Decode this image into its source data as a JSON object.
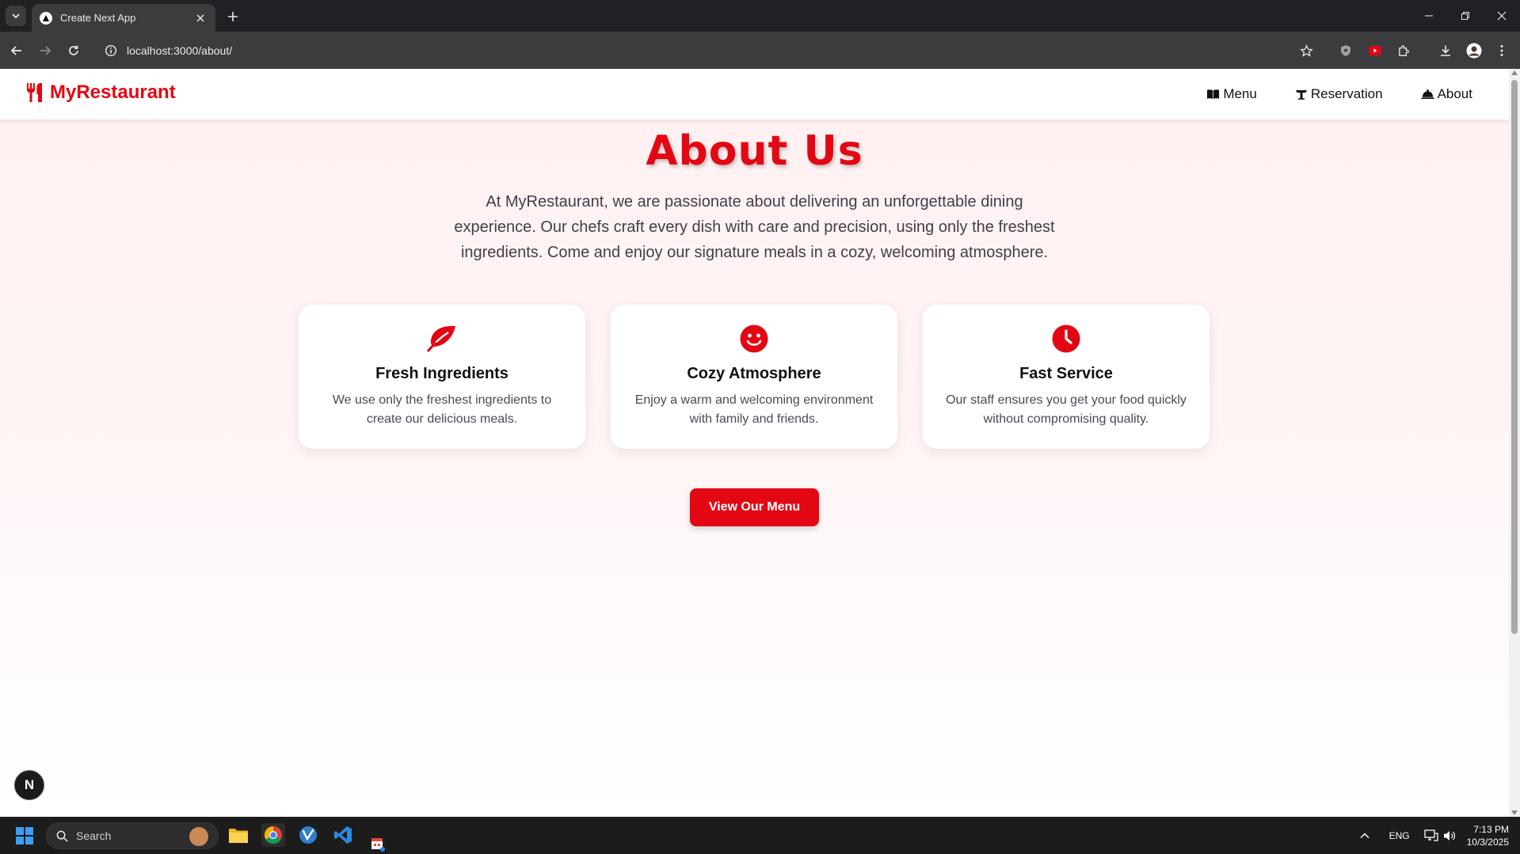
{
  "browser": {
    "tab_title": "Create Next App",
    "url": "localhost:3000/about/"
  },
  "site": {
    "brand": "MyRestaurant",
    "nav": [
      {
        "label": "Menu",
        "icon": "book-icon"
      },
      {
        "label": "Reservation",
        "icon": "table-icon"
      },
      {
        "label": "About",
        "icon": "cloche-icon"
      }
    ]
  },
  "about": {
    "title": "About Us",
    "description": "At MyRestaurant, we are passionate about delivering an unforgettable dining experience. Our chefs craft every dish with care and precision, using only the freshest ingredients. Come and enjoy our signature meals in a cozy, welcoming atmosphere.",
    "features": [
      {
        "icon": "leaf-icon",
        "title": "Fresh Ingredients",
        "text": "We use only the freshest ingredients to create our delicious meals."
      },
      {
        "icon": "smile-icon",
        "title": "Cozy Atmosphere",
        "text": "Enjoy a warm and welcoming environment with family and friends."
      },
      {
        "icon": "clock-icon",
        "title": "Fast Service",
        "text": "Our staff ensures you get your food quickly without compromising quality."
      }
    ],
    "cta_label": "View Our Menu"
  },
  "dev_badge": "N",
  "taskbar": {
    "search_label": "Search",
    "language": "ENG",
    "time": "7:13 PM",
    "date": "10/3/2025"
  },
  "colors": {
    "accent": "#e30613",
    "chrome_dark": "#202124",
    "chrome_toolbar": "#3c3c3f"
  }
}
